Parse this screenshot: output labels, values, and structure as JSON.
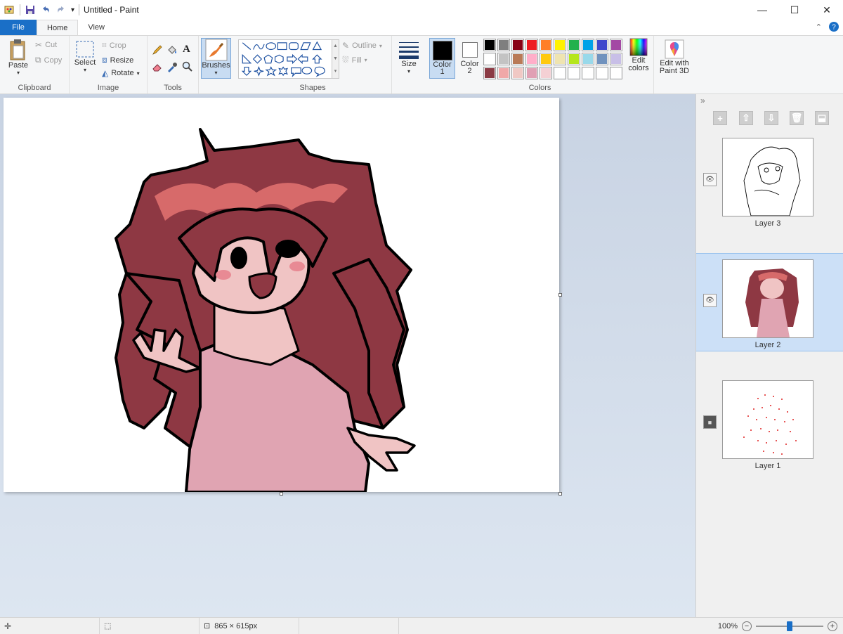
{
  "window": {
    "title": "Untitled - Paint",
    "controls": {
      "minimize": "—",
      "maximize": "☐",
      "close": "✕"
    }
  },
  "tabs": [
    {
      "label": "File"
    },
    {
      "label": "Home"
    },
    {
      "label": "View"
    }
  ],
  "ribbon": {
    "clipboard": {
      "label": "Clipboard",
      "paste": "Paste",
      "cut": "Cut",
      "copy": "Copy"
    },
    "image": {
      "label": "Image",
      "select": "Select",
      "crop": "Crop",
      "resize": "Resize",
      "rotate": "Rotate"
    },
    "tools": {
      "label": "Tools",
      "text_glyph": "A"
    },
    "brushes": {
      "label": "Brushes"
    },
    "shapes": {
      "label": "Shapes",
      "outline": "Outline",
      "fill": "Fill"
    },
    "size": {
      "label": "Size"
    },
    "colors": {
      "label": "Colors",
      "color1": "Color\n1",
      "color1_line1": "Color",
      "color1_line2": "1",
      "color2_line1": "Color",
      "color2_line2": "2",
      "color1_value": "#000000",
      "color2_value": "#ffffff",
      "edit_colors_line1": "Edit",
      "edit_colors_line2": "colors",
      "palette": [
        [
          "#000000",
          "#7f7f7f",
          "#880015",
          "#ed1c24",
          "#ff7f27",
          "#fff200",
          "#22b14c",
          "#00a2e8",
          "#3f48cc",
          "#a349a4"
        ],
        [
          "#ffffff",
          "#c3c3c3",
          "#b97a57",
          "#ffaec9",
          "#ffc90e",
          "#efe4b0",
          "#b5e61d",
          "#99d9ea",
          "#7092be",
          "#c8bfe7"
        ],
        [
          "#8b3a44",
          "#f0a8a8",
          "#f0c8c4",
          "#e0a0b4",
          "#f4d0d4",
          "#ffffff",
          "#ffffff",
          "#ffffff",
          "#ffffff",
          "#ffffff"
        ]
      ]
    },
    "paint3d": {
      "line1": "Edit with",
      "line2": "Paint 3D"
    }
  },
  "layers": {
    "items": [
      {
        "name": "Layer 3",
        "visible": true,
        "selected": false
      },
      {
        "name": "Layer 2",
        "visible": true,
        "selected": true
      },
      {
        "name": "Layer 1",
        "visible": false,
        "selected": false
      }
    ]
  },
  "status": {
    "dimensions": "865 × 615px",
    "zoom": "100%",
    "zoom_level": 0.5
  }
}
